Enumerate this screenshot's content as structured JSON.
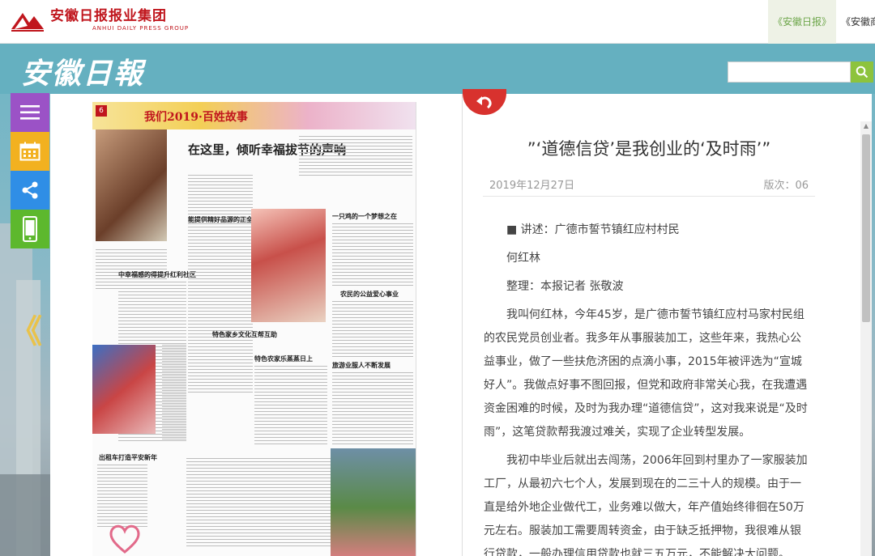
{
  "brand": {
    "group_name_cn": "安徽日报报业集团",
    "group_name_en": "ANHUI DAILY PRESS GROUP",
    "masthead": "安徽日報"
  },
  "nav": {
    "items": [
      {
        "label": "《安徽日报》",
        "active": true
      },
      {
        "label": "《安徽商"
      }
    ]
  },
  "search": {
    "placeholder": "",
    "value": ""
  },
  "toolbar": {
    "icons": [
      "menu-icon",
      "calendar-icon",
      "share-icon",
      "mobile-icon"
    ],
    "prev_glyph": "《"
  },
  "paper": {
    "page_no": "6",
    "banner_text": "我们2019·百姓故事",
    "headline": "在这里，倾听幸福拔节的声响",
    "small_heads": [
      "中幸福感的得提升红利社区",
      "能提供精好品源的正全",
      "一只鸡的一个梦想之在",
      "农民的公益爱心事业",
      "特色家乡文化互帮互助",
      "特色农家乐蒸蒸日上",
      "旅游业服人不断发展",
      "出租车打造平安新年"
    ]
  },
  "article": {
    "title": "”‘道德信贷’是我创业的‘及时雨’”",
    "date": "2019年12月27日",
    "page": "版次：06",
    "paragraphs": [
      "■ 讲述：广德市誓节镇红应村村民",
      "何红林",
      "整理：本报记者 张敬波",
      "我叫何红林，今年45岁，是广德市誓节镇红应村马家村民组的农民党员创业者。我多年从事服装加工，这些年来，我热心公益事业，做了一些扶危济困的点滴小事，2015年被评选为“宣城好人”。我做点好事不图回报，但党和政府非常关心我，在我遭遇资金困难的时候，及时为我办理“道德信贷”，这对我来说是“及时雨”，这笔贷款帮我渡过难关，实现了企业转型发展。",
      "我初中毕业后就出去闯荡，2006年回到村里办了一家服装加工厂，从最初六七个人，发展到现在的二三十人的规模。由于一直是给外地企业做代工，业务难以做大，年产值始终徘徊在50万元左右。服装加工需要周转资金，由于缺乏抵押物，我很难从银行贷款，一般办理信用贷款也就三五万元，不能解决大问题。"
    ]
  },
  "colors": {
    "brand_red": "#c0161d",
    "header_blue": "#65b0c0",
    "menu_purple": "#9b52c6",
    "calendar_orange": "#f2b120",
    "share_blue": "#2f8ee6",
    "mobile_green": "#5db82d",
    "search_green": "#8dc33d",
    "back_red": "#d8322e",
    "nav_active": "#6da64a"
  }
}
